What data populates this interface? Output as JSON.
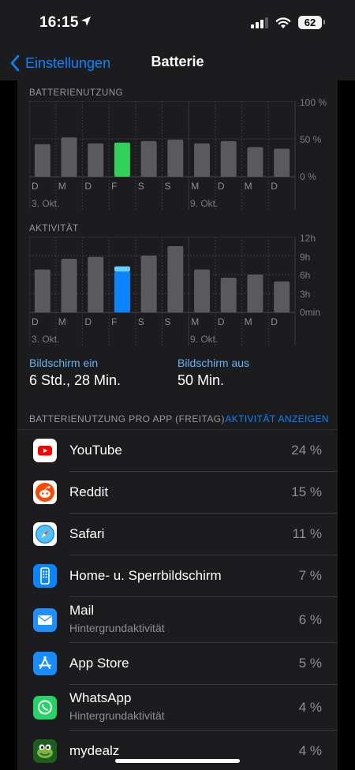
{
  "status_bar": {
    "time": "16:15",
    "battery_level": "62"
  },
  "nav": {
    "back_label": "Einstellungen",
    "title": "Batterie"
  },
  "battery_chart": {
    "section_label": "BATTERIENUTZUNG",
    "y_labels": [
      "100 %",
      "50 %",
      "0 %"
    ],
    "days": [
      "D",
      "M",
      "D",
      "F",
      "S",
      "S",
      "M",
      "D",
      "M",
      "D"
    ],
    "dates": [
      "3. Okt.",
      "9. Okt."
    ],
    "highlight_color": "#30d158",
    "bar_color": "#5a5a5e"
  },
  "activity_chart": {
    "section_label": "AKTIVITÄT",
    "y_labels": [
      "12h",
      "9h",
      "6h",
      "3h",
      "0min"
    ],
    "days": [
      "D",
      "M",
      "D",
      "F",
      "S",
      "S",
      "M",
      "D",
      "M",
      "D"
    ],
    "dates": [
      "3. Okt.",
      "9. Okt."
    ],
    "highlight_screen_on_color": "#0a84ff",
    "highlight_screen_off_color": "#64d2ff",
    "bar_color": "#5a5a5e"
  },
  "chart_data": [
    {
      "type": "bar",
      "title": "BATTERIENUTZUNG",
      "categories": [
        "D",
        "M",
        "D",
        "F",
        "S",
        "S",
        "M",
        "D",
        "M",
        "D"
      ],
      "series": [
        {
          "values": [
            43,
            52,
            44,
            45,
            47,
            49,
            44,
            47,
            39,
            37
          ]
        }
      ],
      "ylim": [
        0,
        100
      ],
      "highlight_index": 3
    },
    {
      "type": "bar",
      "title": "AKTIVITÄT",
      "categories": [
        "D",
        "M",
        "D",
        "F",
        "S",
        "S",
        "M",
        "D",
        "M",
        "D"
      ],
      "series": [
        {
          "name": "Bildschirm ein",
          "values": [
            6.8,
            8.5,
            8.8,
            6.47,
            9.0,
            10.5,
            6.8,
            5.5,
            6.0,
            4.9
          ]
        },
        {
          "name": "Bildschirm aus",
          "values": [
            0,
            0,
            0,
            0.83,
            0,
            0,
            0,
            0,
            0,
            0
          ]
        }
      ],
      "ylim": [
        0,
        12
      ],
      "stacked": true,
      "highlight_index": 3
    }
  ],
  "screen": {
    "on_label": "Bildschirm ein",
    "on_value": "6 Std., 28 Min.",
    "off_label": "Bildschirm aus",
    "off_value": "50 Min."
  },
  "per_app": {
    "header": "BATTERIENUTZUNG PRO APP (FREITAG)",
    "action": "AKTIVITÄT ANZEIGEN",
    "apps": [
      {
        "name": "YouTube",
        "sub": "",
        "pct": "24 %",
        "icon": "youtube-icon"
      },
      {
        "name": "Reddit",
        "sub": "",
        "pct": "15 %",
        "icon": "reddit-icon"
      },
      {
        "name": "Safari",
        "sub": "",
        "pct": "11 %",
        "icon": "safari-icon"
      },
      {
        "name": "Home- u. Sperrbildschirm",
        "sub": "",
        "pct": "7 %",
        "icon": "homescreen-icon"
      },
      {
        "name": "Mail",
        "sub": "Hintergrundaktivität",
        "pct": "6 %",
        "icon": "mail-icon"
      },
      {
        "name": "App Store",
        "sub": "",
        "pct": "5 %",
        "icon": "appstore-icon"
      },
      {
        "name": "WhatsApp",
        "sub": "Hintergrundaktivität",
        "pct": "4 %",
        "icon": "whatsapp-icon"
      },
      {
        "name": "mydealz",
        "sub": "",
        "pct": "4 %",
        "icon": "mydealz-icon"
      }
    ]
  }
}
